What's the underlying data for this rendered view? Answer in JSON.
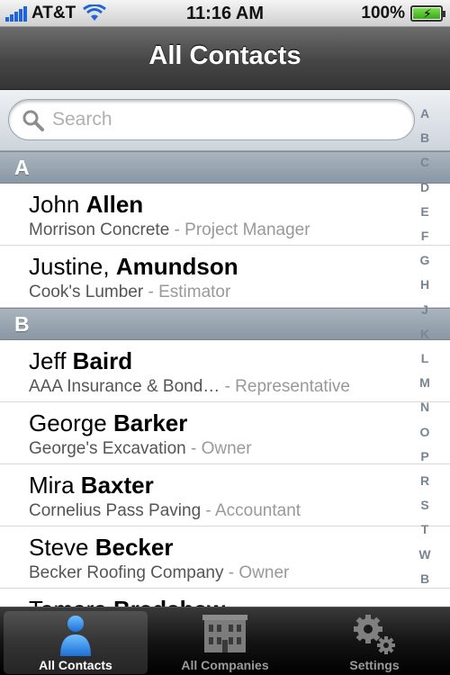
{
  "status": {
    "carrier": "AT&T",
    "time": "11:16 AM",
    "battery": "100%",
    "battery_level": 1.0
  },
  "nav": {
    "title": "All Contacts"
  },
  "search": {
    "placeholder": "Search"
  },
  "sections": [
    {
      "letter": "A",
      "contacts": [
        {
          "first": "John",
          "last": "Allen",
          "company": "Morrison Concrete",
          "role": " - Project Manager"
        },
        {
          "first": "Justine,",
          "last": "Amundson",
          "company": "Cook's Lumber",
          "role": " - Estimator"
        }
      ]
    },
    {
      "letter": "B",
      "contacts": [
        {
          "first": "Jeff",
          "last": "Baird",
          "company": "AAA Insurance & Bond…",
          "role": " - Representative"
        },
        {
          "first": "George",
          "last": "Barker",
          "company": "George's Excavation",
          "role": " - Owner"
        },
        {
          "first": "Mira",
          "last": "Baxter",
          "company": "Cornelius Pass Paving",
          "role": " - Accountant"
        },
        {
          "first": "Steve",
          "last": "Becker",
          "company": "Becker Roofing Company",
          "role": " - Owner"
        },
        {
          "first": "Tamara",
          "last": "Bradshaw",
          "company": "",
          "role": ""
        }
      ]
    }
  ],
  "index_letters": [
    "A",
    "B",
    "C",
    "D",
    "E",
    "F",
    "G",
    "H",
    "J",
    "K",
    "L",
    "M",
    "N",
    "O",
    "P",
    "R",
    "S",
    "T",
    "W",
    "B"
  ],
  "tabs": [
    {
      "label": "All Contacts",
      "icon": "person-icon",
      "selected": true
    },
    {
      "label": "All Companies",
      "icon": "building-icon",
      "selected": false
    },
    {
      "label": "Settings",
      "icon": "gear-icon",
      "selected": false
    }
  ],
  "colors": {
    "signal": "#1f64d8",
    "section_header": "#8a97a4",
    "person_icon": "#2f8ff0"
  }
}
